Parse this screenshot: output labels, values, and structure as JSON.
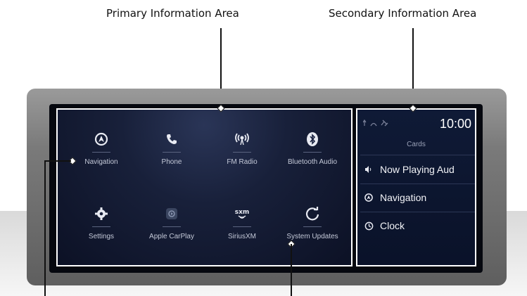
{
  "callouts": {
    "primary": "Primary Information Area",
    "secondary": "Secondary Information Area"
  },
  "apps": [
    {
      "label": "Navigation",
      "icon": "navigation-icon"
    },
    {
      "label": "Phone",
      "icon": "phone-icon"
    },
    {
      "label": "FM Radio",
      "icon": "radio-icon"
    },
    {
      "label": "Bluetooth Audio",
      "icon": "bluetooth-icon"
    },
    {
      "label": "Settings",
      "icon": "gear-icon"
    },
    {
      "label": "Apple CarPlay",
      "icon": "carplay-icon"
    },
    {
      "label": "SiriusXM",
      "icon": "siriusxm-icon"
    },
    {
      "label": "System Updates",
      "icon": "refresh-icon"
    }
  ],
  "secondary": {
    "time": "10:00",
    "cards_title": "Cards",
    "cards": [
      {
        "label": "Now Playing Aud",
        "icon": "speaker-icon"
      },
      {
        "label": "Navigation",
        "icon": "navigation-icon"
      },
      {
        "label": "Clock",
        "icon": "clock-icon"
      }
    ]
  },
  "colors": {
    "screen_bg": "#0c1125",
    "label_text": "#c4c9d8",
    "card_text": "#f2f3f7"
  }
}
